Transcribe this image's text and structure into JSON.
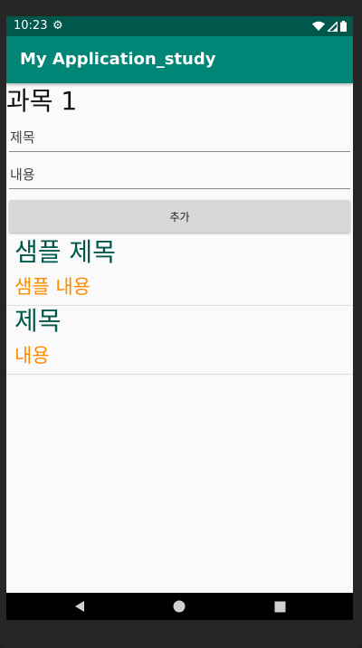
{
  "status_bar": {
    "time": "10:23"
  },
  "toolbar": {
    "title": "My Application_study"
  },
  "subject": {
    "title": "과목 1"
  },
  "form": {
    "title_placeholder": "제목",
    "content_placeholder": "내용",
    "add_label": "추가"
  },
  "list": [
    {
      "title": "샘플 제목",
      "content": "샘플 내용"
    },
    {
      "title": "제목",
      "content": "내용"
    }
  ],
  "colors": {
    "status_bar": "#00574b",
    "toolbar": "#008577",
    "item_title": "#00574b",
    "item_content": "#ff8c00"
  },
  "icons": {
    "status": [
      "settings-gear-icon",
      "wifi-icon",
      "signal-icon",
      "battery-icon"
    ],
    "nav": [
      "back-icon",
      "home-icon",
      "recents-icon"
    ]
  }
}
